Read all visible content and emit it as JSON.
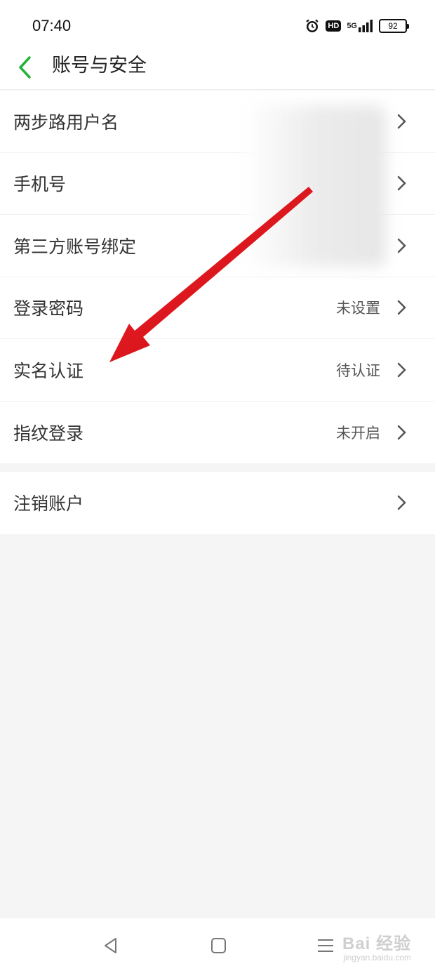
{
  "status_bar": {
    "time": "07:40",
    "icons": [
      "alarm-icon",
      "hd-icon",
      "5g-signal-icon",
      "battery-icon"
    ],
    "hd_label": "HD",
    "network_label": "5G",
    "battery_level": "92"
  },
  "header": {
    "back_icon": "chevron-left-icon",
    "title": "账号与安全",
    "accent_color": "#22b33a"
  },
  "rows": [
    {
      "label": "两步路用户名",
      "value": ""
    },
    {
      "label": "手机号",
      "value": ""
    },
    {
      "label": "第三方账号绑定",
      "value": ""
    },
    {
      "label": "登录密码",
      "value": "未设置"
    },
    {
      "label": "实名认证",
      "value": "待认证"
    },
    {
      "label": "指纹登录",
      "value": "未开启"
    }
  ],
  "section2_rows": [
    {
      "label": "注销账户",
      "value": ""
    }
  ],
  "annotation": {
    "arrow_color": "#e8141b"
  },
  "nav": {
    "icons": [
      "back-triangle-icon",
      "home-square-icon",
      "menu-lines-icon"
    ]
  },
  "watermark": {
    "main": "Bai 经验",
    "sub": "jingyan.baidu.com"
  }
}
